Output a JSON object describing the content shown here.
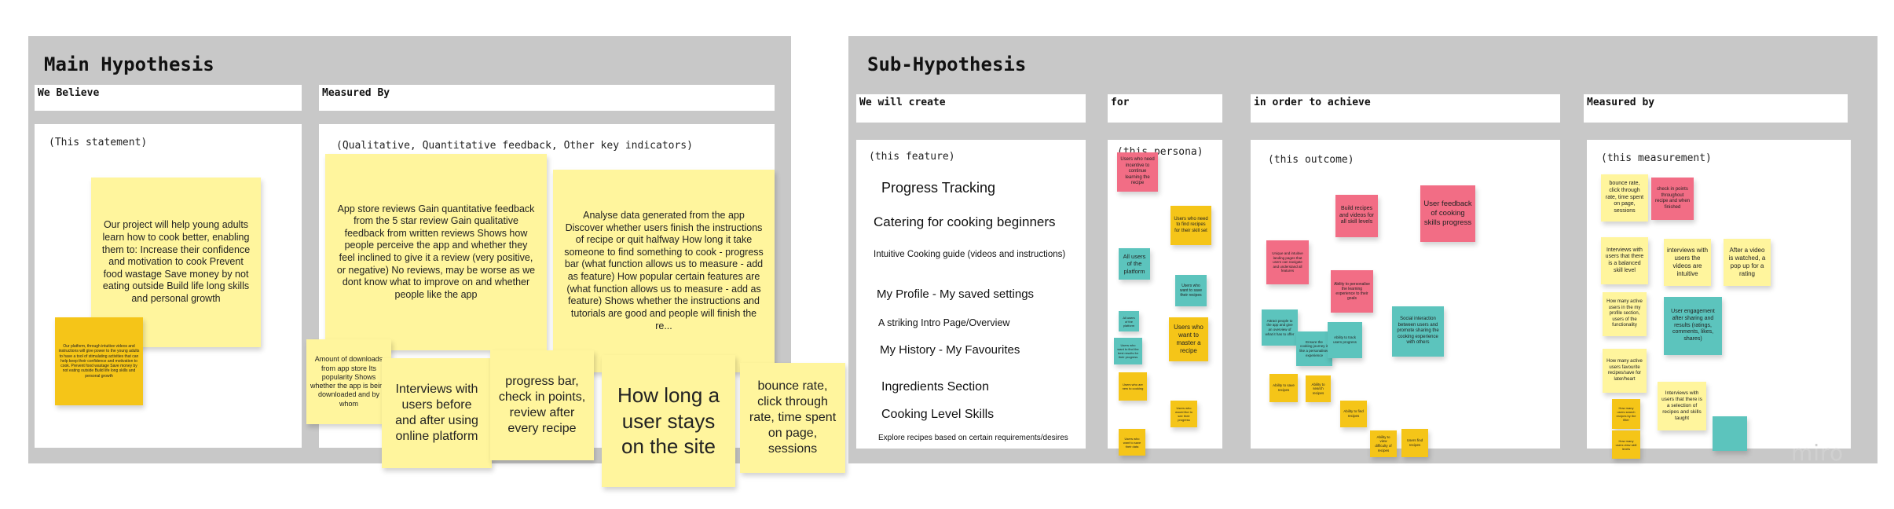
{
  "main": {
    "title": "Main Hypothesis",
    "we_believe": {
      "header": "We Believe",
      "hint": "(This statement)",
      "statement": "Our project will help young adults learn how to cook better, enabling them to: Increase their confidence and motivation to cook Prevent food wastage Save money by not eating outside Build life long skills and personal growth",
      "small_note": "Our platform, through intuitive videos and instructions will give power to the young adults to have a tool of stimulating activities that can help keep their confidence and motivation to cook. Prevent food wastage Save money by not eating outside Build life long skills and personal growth"
    },
    "measured_by": {
      "header": "Measured By",
      "hint": "(Qualitative, Quantitative feedback, Other key indicators)",
      "app_store": "App store reviews Gain quantitative feedback from the 5 star review Gain qualitative feedback from written reviews Shows how people perceive the app and whether they feel inclined to give it a review (very positive, or negative) No reviews, may be worse as we dont know what to improve on and whether people like the app",
      "analyse": "Analyse data generated from the app Discover whether users finish the instructions of recipe or quit halfway How long it take someone to find something to cook - progress bar (what function allows us to measure - add as feature) How popular certain features are (what function allows us to measure - add as feature) Shows whether the instructions and tutorials are good and people will finish the re...",
      "downloads": "Amount of downloads from app store Its popularity Shows whether the app is being downloaded and by whom",
      "interviews": "Interviews with users before and after using online platform",
      "progress": "progress bar, check in points, review after every recipe",
      "how_long": "How long a user stays on the site",
      "bounce": "bounce rate, click through rate, time spent on page, sessions"
    }
  },
  "sub": {
    "title": "Sub-Hypothesis",
    "create": {
      "header": "We will create",
      "hint": "(this feature)",
      "features": [
        "Progress Tracking",
        "Catering for cooking beginners",
        "Intuitive Cooking guide (videos and instructions)",
        "My Profile - My saved settings",
        "A striking Intro Page/Overview",
        "My History - My Favourites",
        "Ingredients Section",
        "Cooking Level Skills",
        "Explore recipes based on certain requirements/desires"
      ]
    },
    "for": {
      "header": "for",
      "hint": "(this persona)",
      "notes": {
        "n1": "Users who need incentive to continue learning the recipe",
        "n2": "Users who need to find recipes for their skill set",
        "n3": "All users of the platform",
        "n4": "Users who want to master a recipe",
        "n5": "All users of the platform",
        "n6": "Users who want to save their recipes",
        "n7": "Users who want to find the best results for their progress",
        "n8": "Users who are new to cooking",
        "n9": "Users who would like to see their progress",
        "n10": "Users who want to save their data",
        "n11": "Users who want to learn",
        "n12": "Users who want to learn new things"
      }
    },
    "achieve": {
      "header": "in order to achieve",
      "hint": "(this outcome)",
      "notes": {
        "a1": "Build recipes and videos for all skill levels",
        "a2": "User feedback of cooking skills progress",
        "a3": "Unique and intuitive landing pages that users can navigate and understand all features",
        "a4": "Ability to personalise the learning experience to their goals",
        "a5": "Attract people to the app and give an overview of what it has to offer",
        "a6": "Ensure the cooking journey is like a personalised experience",
        "a7": "Ability to track users progress",
        "a8": "Social interaction between users and promote sharing the cooking experience with others",
        "a9": "Ability to save recipes",
        "a10": "Ability to search recipes",
        "a11": "Ability to find recipes",
        "a12": "Ability to view difficulty of recipes",
        "a13": "Users find recipes"
      }
    },
    "measured": {
      "header": "Measured by",
      "hint": "(this measurement)",
      "notes": {
        "m1": "bounce rate, click through rate, time spent on page, sessions",
        "m2": "check in points throughout recipe and when finished",
        "m3": "Interviews with users that there is a balanced skill level",
        "m4": "interviews with users the videos are intuitive",
        "m5": "After a video is watched, a pop up for a rating",
        "m6": "How many active users in the my profile section, users of the functionality",
        "m7": "User engagement after sharing and results (ratings, comments, likes, shares)",
        "m8": "How many active users favourite recipes/save for later/heart",
        "m9": "Interviews with users that there is a selection of recipes and skills taught",
        "m10": "How many users search recipes by the filter",
        "m11": "How many users view skill levels"
      }
    }
  },
  "watermark": "miro"
}
